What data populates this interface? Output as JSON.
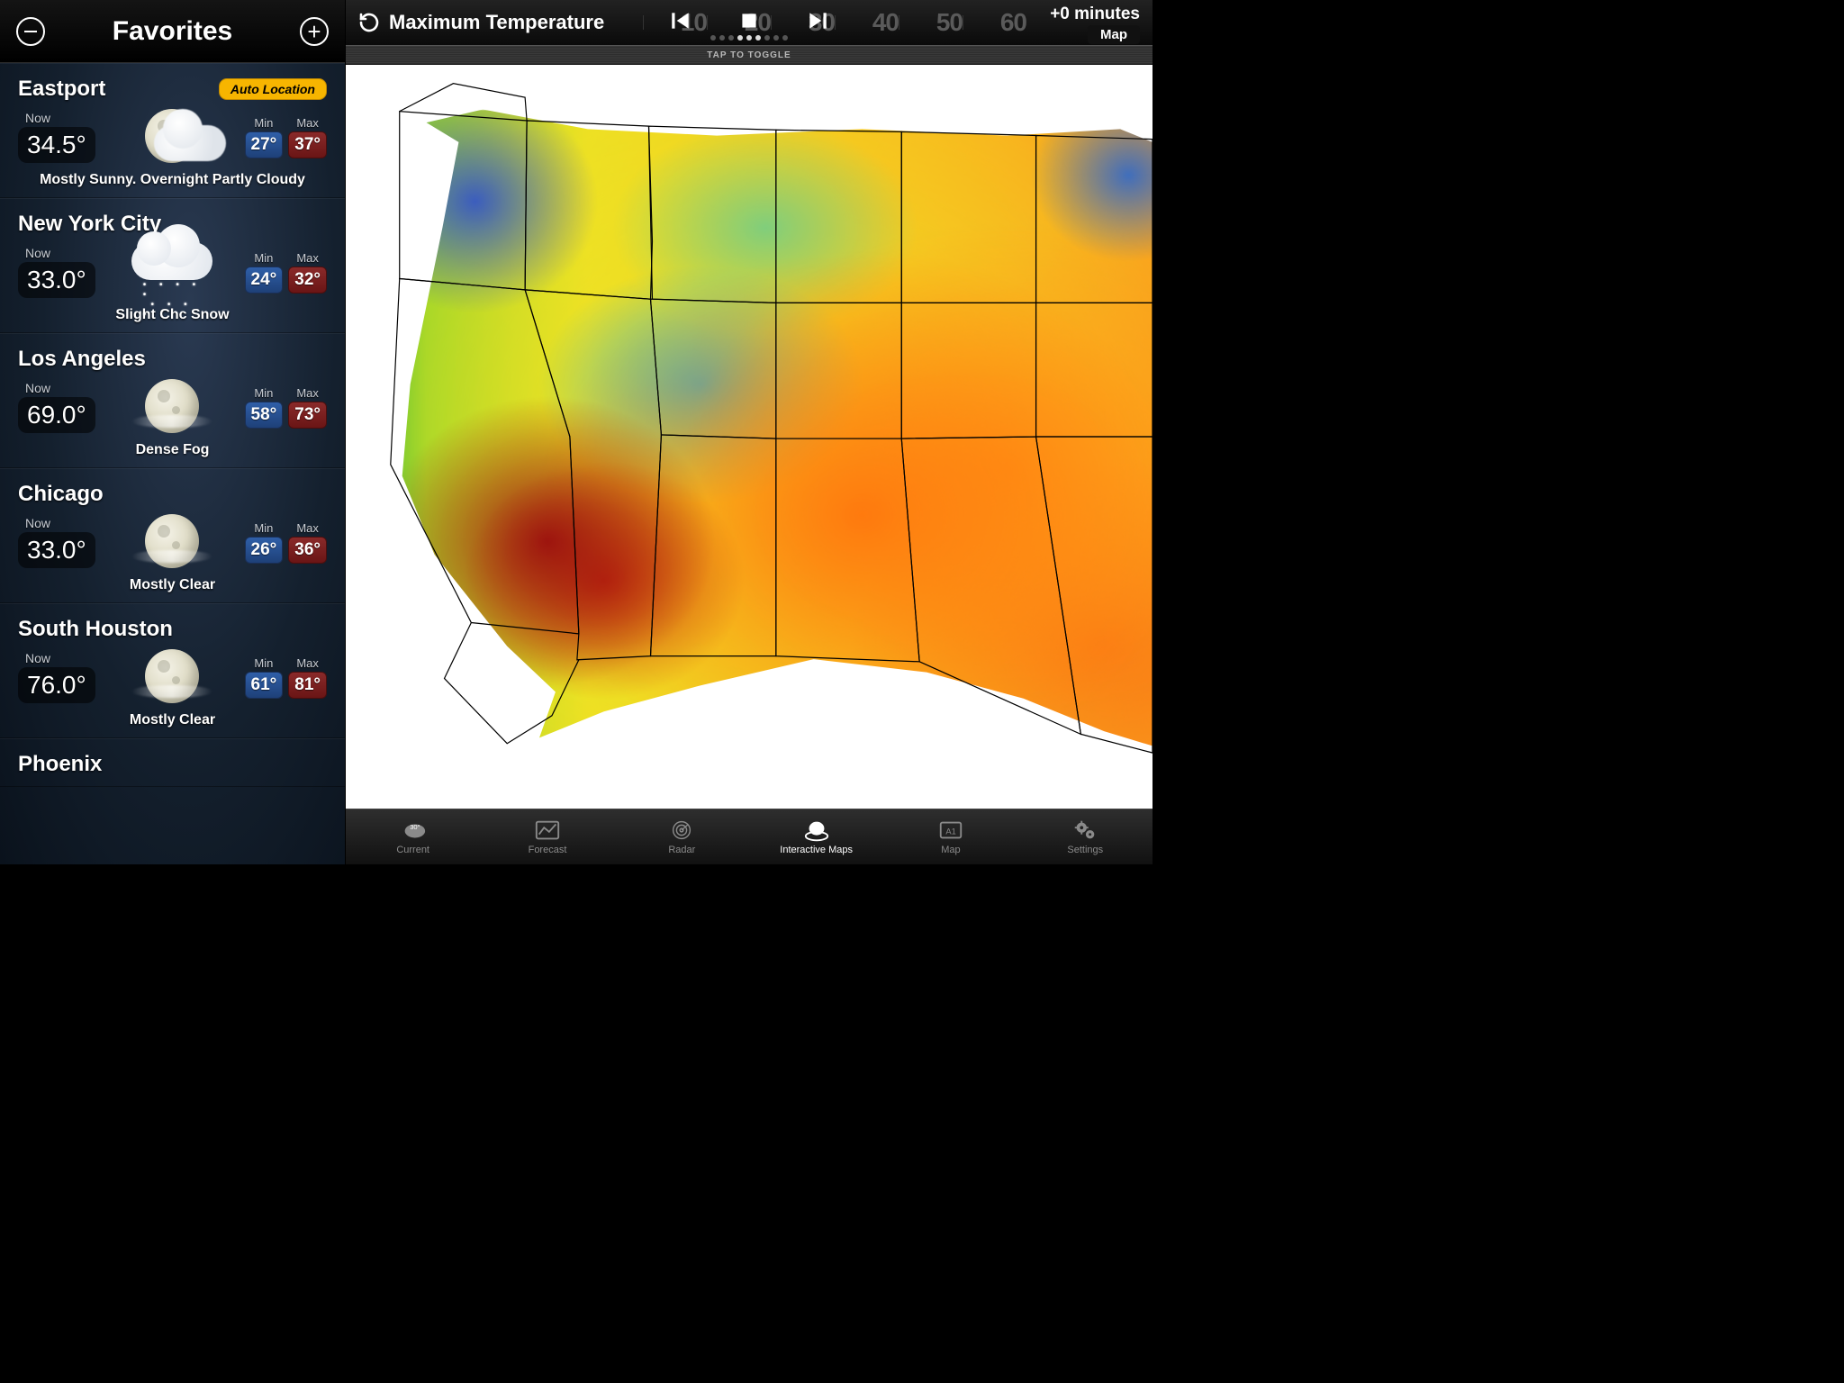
{
  "sidebar": {
    "title": "Favorites",
    "auto_badge": "Auto Location",
    "labels": {
      "now": "Now",
      "min": "Min",
      "max": "Max"
    },
    "locations": [
      {
        "name": "Eastport",
        "auto": true,
        "now": "34.5°",
        "min": "27°",
        "max": "37°",
        "cond": "Mostly Sunny. Overnight Partly Cloudy",
        "icon": "moon-cloud"
      },
      {
        "name": "New York City",
        "auto": false,
        "now": "33.0°",
        "min": "24°",
        "max": "32°",
        "cond": "Slight Chc Snow",
        "icon": "snow"
      },
      {
        "name": "Los Angeles",
        "auto": false,
        "now": "69.0°",
        "min": "58°",
        "max": "73°",
        "cond": "Dense Fog",
        "icon": "moon"
      },
      {
        "name": "Chicago",
        "auto": false,
        "now": "33.0°",
        "min": "26°",
        "max": "36°",
        "cond": "Mostly Clear",
        "icon": "moon"
      },
      {
        "name": "South Houston",
        "auto": false,
        "now": "76.0°",
        "min": "61°",
        "max": "81°",
        "cond": "Mostly Clear",
        "icon": "moon"
      },
      {
        "name": "Phoenix",
        "auto": false,
        "now": "",
        "min": "",
        "max": "",
        "cond": "",
        "icon": "none"
      }
    ]
  },
  "map": {
    "layer_title": "Maximum Temperature",
    "time_offset": "+0 minutes",
    "map_button": "Map",
    "toggle_hint": "TAP TO TOGGLE",
    "ruler_ticks": [
      "10",
      "20",
      "30",
      "40",
      "50",
      "60"
    ]
  },
  "tabs": [
    {
      "id": "current",
      "label": "Current"
    },
    {
      "id": "forecast",
      "label": "Forecast"
    },
    {
      "id": "radar",
      "label": "Radar"
    },
    {
      "id": "interactive",
      "label": "Interactive Maps"
    },
    {
      "id": "map",
      "label": "Map"
    },
    {
      "id": "settings",
      "label": "Settings"
    }
  ],
  "active_tab": "interactive"
}
